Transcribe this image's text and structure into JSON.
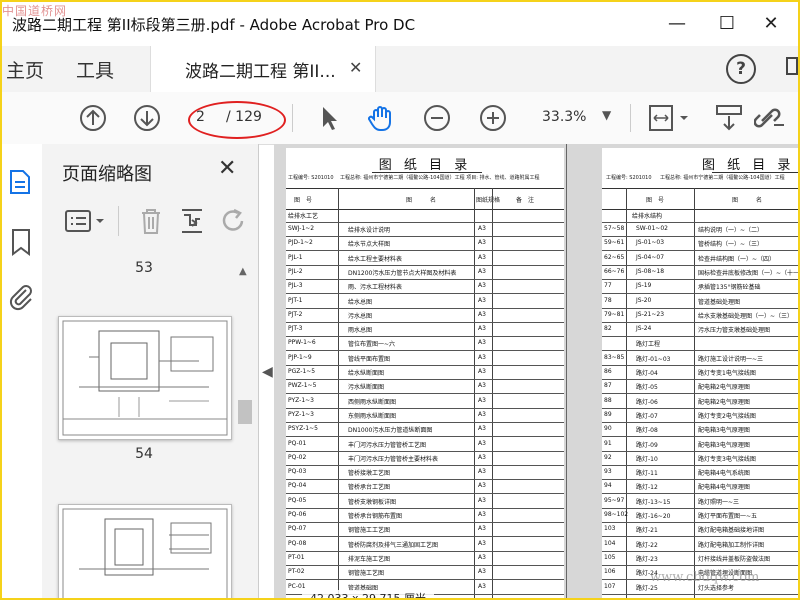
{
  "window": {
    "watermark": "中国道桥网",
    "title": "波路二期工程  第II标段第三册.pdf - Adobe Acrobat Pro DC",
    "minimize": "—",
    "maximize": "☐",
    "close": "✕"
  },
  "tabs": {
    "home": "主页",
    "tools": "工具",
    "doc_tab": "波路二期工程  第II...",
    "doc_tab_close": "✕",
    "help": "?"
  },
  "toolbar": {
    "current_page": "2",
    "total_pages": "/ 129",
    "zoom": "33.3%"
  },
  "thumbnails": {
    "panel_title": "页面缩略图",
    "close": "✕",
    "page_numbers": [
      "53",
      "54"
    ]
  },
  "document": {
    "left_page": {
      "title": "图 纸 目 录",
      "code": "工程编号: S201010",
      "project": "工程总称: 福州市宁德第二期（福鳌公路-104国道）工程   项目: 排水、管线、道路附属工程",
      "headers": [
        "图　号",
        "图　　　名",
        "图纸规格",
        "备　注"
      ],
      "section": "给排水工艺",
      "rows": [
        {
          "no": "SWJ-1~2",
          "name": "给排水设计说明",
          "size": "A3"
        },
        {
          "no": "PJD-1~2",
          "name": "给水节点大样图",
          "size": "A3"
        },
        {
          "no": "PJL-1",
          "name": "给水工程主要材料表",
          "size": "A3"
        },
        {
          "no": "PJL-2",
          "name": "DN1200污水压力管节点大样图及材料表",
          "size": "A3"
        },
        {
          "no": "PJL-3",
          "name": "雨、污水工程材料表",
          "size": "A3"
        },
        {
          "no": "PJT-1",
          "name": "给水总图",
          "size": "A3"
        },
        {
          "no": "PJT-2",
          "name": "污水总图",
          "size": "A3"
        },
        {
          "no": "PJT-3",
          "name": "雨水总图",
          "size": "A3"
        },
        {
          "no": "PPW-1~6",
          "name": "管位布置图一~六",
          "size": "A3"
        },
        {
          "no": "PJP-1~9",
          "name": "管线平面布置图",
          "size": "A3"
        },
        {
          "no": "PGZ-1~5",
          "name": "给水纵断面图",
          "size": "A3"
        },
        {
          "no": "PWZ-1~5",
          "name": "污水纵断面图",
          "size": "A3"
        },
        {
          "no": "PYZ-1~3",
          "name": "西侧雨水纵断面图",
          "size": "A3"
        },
        {
          "no": "PYZ-1~3",
          "name": "东侧雨水纵断面图",
          "size": "A3"
        },
        {
          "no": "PSYZ-1~5",
          "name": "DN1000污水压力管道纵断面图",
          "size": "A3"
        },
        {
          "no": "PQ-01",
          "name": "丰门河污水压力管管桥工艺图",
          "size": "A3"
        },
        {
          "no": "PQ-02",
          "name": "丰门河污水压力管管桥主要材料表",
          "size": "A3"
        },
        {
          "no": "PQ-03",
          "name": "管桥接墩工艺图",
          "size": "A3"
        },
        {
          "no": "PQ-04",
          "name": "管桥承台工艺图",
          "size": "A3"
        },
        {
          "no": "PQ-05",
          "name": "管桥支墩钢板详图",
          "size": "A3"
        },
        {
          "no": "PQ-06",
          "name": "管桥承台钢筋布置图",
          "size": "A3"
        },
        {
          "no": "PQ-07",
          "name": "钢管施工工艺图",
          "size": "A3"
        },
        {
          "no": "PQ-08",
          "name": "管桥防腐剂及排气三通加固工艺图",
          "size": "A3"
        },
        {
          "no": "PT-01",
          "name": "排泥车施工艺图",
          "size": "A3"
        },
        {
          "no": "PT-02",
          "name": "钢管施工艺图",
          "size": "A3"
        },
        {
          "no": "PC-01",
          "name": "管道基础图",
          "size": "A3"
        }
      ]
    },
    "right_page": {
      "title": "图 纸 目 录",
      "code": "工程编号: S201010",
      "project": "工程总称: 福州市宁德第二期（福鳌公路-104国道）工程",
      "headers": [
        "图　号",
        "图　　　名"
      ],
      "section": "给排水结构",
      "rows": [
        {
          "idx": "57~58",
          "no": "SW-01~02",
          "name": "结构说明（一）~（二）"
        },
        {
          "idx": "59~61",
          "no": "JS-01~03",
          "name": "管桥结构（一）~（三）"
        },
        {
          "idx": "62~65",
          "no": "JS-04~07",
          "name": "检查井结构图（一）~（四）"
        },
        {
          "idx": "66~76",
          "no": "JS-08~18",
          "name": "国标检查井底板修改图（一）~（十一）"
        },
        {
          "idx": "77",
          "no": "JS-19",
          "name": "承插管135°钢筋砼基础"
        },
        {
          "idx": "78",
          "no": "JS-20",
          "name": "管道基础处理图"
        },
        {
          "idx": "79~81",
          "no": "JS-21~23",
          "name": "给水支墩基础处理图（一）~（三）"
        },
        {
          "idx": "82",
          "no": "JS-24",
          "name": "污水压力管支墩基础处理图"
        },
        {
          "idx": "",
          "no": "路灯工程",
          "name": ""
        },
        {
          "idx": "83~85",
          "no": "路灯-01~03",
          "name": "路灯施工设计说明一~三"
        },
        {
          "idx": "86",
          "no": "路灯-04",
          "name": "路灯专变1电气接线图"
        },
        {
          "idx": "87",
          "no": "路灯-05",
          "name": "配电箱2电气原理图"
        },
        {
          "idx": "88",
          "no": "路灯-06",
          "name": "配电箱2电气原理图"
        },
        {
          "idx": "89",
          "no": "路灯-07",
          "name": "路灯专变2电气接线图"
        },
        {
          "idx": "90",
          "no": "路灯-08",
          "name": "配电箱3电气原理图"
        },
        {
          "idx": "91",
          "no": "路灯-09",
          "name": "配电箱3电气原理图"
        },
        {
          "idx": "92",
          "no": "路灯-10",
          "name": "路灯专变3电气接线图"
        },
        {
          "idx": "93",
          "no": "路灯-11",
          "name": "配电箱4电气系统图"
        },
        {
          "idx": "94",
          "no": "路灯-12",
          "name": "配电箱4电气原理图"
        },
        {
          "idx": "95~97",
          "no": "路灯-13~15",
          "name": "路灯照明一~三"
        },
        {
          "idx": "98~102",
          "no": "路灯-16~20",
          "name": "路灯平面布置图一~五"
        },
        {
          "idx": "103",
          "no": "路灯-21",
          "name": "路灯配电箱基础接地详图"
        },
        {
          "idx": "104",
          "no": "路灯-22",
          "name": "路灯配电箱加工制作详图"
        },
        {
          "idx": "105",
          "no": "路灯-23",
          "name": "灯杆接线井盖板防盗做法图"
        },
        {
          "idx": "106",
          "no": "路灯-24",
          "name": "电缆管道埋设断面图"
        },
        {
          "idx": "107",
          "no": "路灯-25",
          "name": "灯头选择参考"
        }
      ]
    },
    "status_tip": "42.033 x 29.715 厘米",
    "watermark2": "www.cbdqw.com"
  },
  "colors": {
    "accent_yellow": "#f5d21a",
    "annotation_red": "#e02020",
    "icon_gray": "#555555"
  }
}
